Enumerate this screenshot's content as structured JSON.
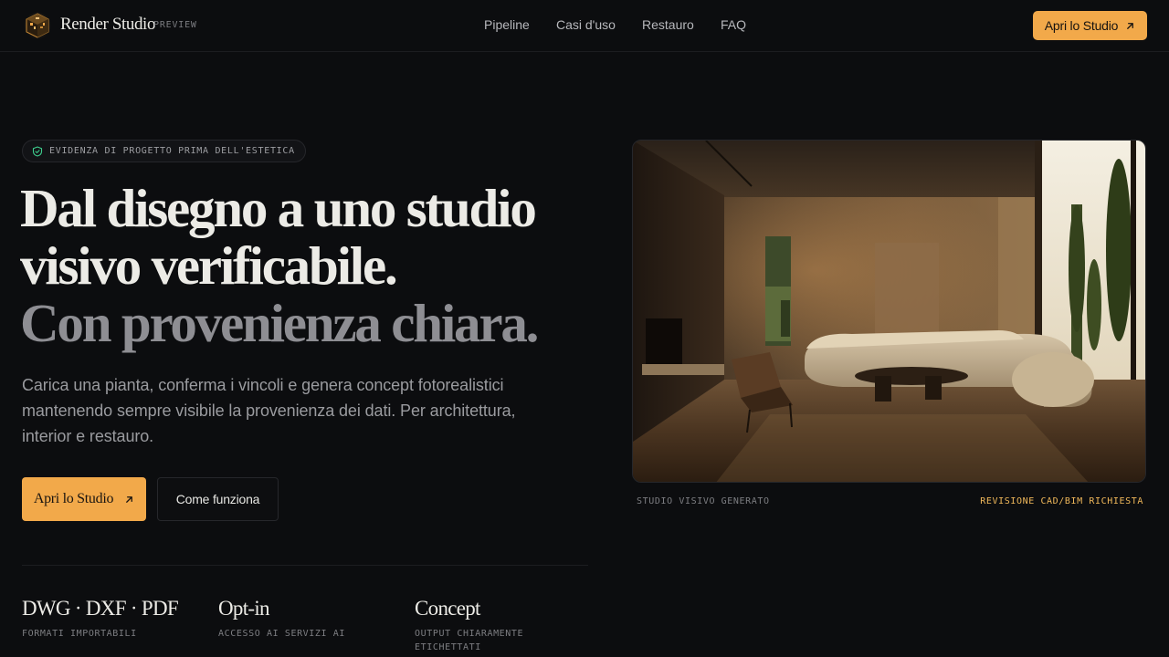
{
  "nav": {
    "brand": "Render Studio",
    "tag": "PREVIEW",
    "links": [
      "Pipeline",
      "Casi d'uso",
      "Restauro",
      "FAQ"
    ],
    "cta": "Apri lo Studio"
  },
  "hero": {
    "badge": "EVIDENZA DI PROGETTO PRIMA DELL'ESTETICA",
    "headline_line1": "Dal disegno a uno studio visivo verificabile.",
    "headline_line2": "Con provenienza chiara.",
    "lede": "Carica una pianta, conferma i vincoli e genera concept fotorealistici mantenendo sempre visibile la provenienza dei dati. Per architettura, interior e restauro.",
    "primary_cta": "Apri lo Studio",
    "secondary_cta": "Come funziona"
  },
  "stats": [
    {
      "value": "DWG · DXF · PDF",
      "label": "FORMATI IMPORTABILI"
    },
    {
      "value": "Opt-in",
      "label": "ACCESSO AI SERVIZI AI"
    },
    {
      "value": "Concept",
      "label": "OUTPUT CHIARAMENTE ETICHETTATI"
    }
  ],
  "render": {
    "caption_left": "STUDIO VISIVO GENERATO",
    "caption_right": "REVISIONE CAD/BIM RICHIESTA"
  },
  "colors": {
    "background": "#0c0d0f",
    "accent": "#f2a94a",
    "caption_accent": "#f0b85a",
    "badge_icon": "#3ecf8e"
  },
  "icons": [
    "cube-logo-icon",
    "shield-check-icon",
    "arrow-up-right-icon"
  ]
}
